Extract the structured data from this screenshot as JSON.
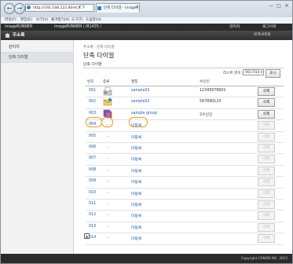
{
  "browser": {
    "address": "http://192.168.222.80/e_a...",
    "tab_title": "단축 다이얼 - imageR...",
    "back_icon": "back-arrow-icon",
    "forward_icon": "forward-arrow-icon",
    "close_tab": "×",
    "win_buttons": [
      "—",
      "□",
      "✕"
    ],
    "menu": [
      "파일(F)",
      "편집(E)",
      "보기(V)",
      "즐겨찾기(A)",
      "도구(T)",
      "도움말(H)"
    ]
  },
  "app": {
    "device": "imageRUNNER",
    "model": "imageRUNNER / iR1435 /",
    "admin": "관리자",
    "logout": "로그아웃",
    "home_label": "주소록",
    "portal": "원격UI포털"
  },
  "sidebar": {
    "items": [
      {
        "label": "원터치"
      },
      {
        "label": "단축 다이얼"
      }
    ]
  },
  "main": {
    "breadcrumb": "주소록 : 단축 다이얼",
    "title": "단축 다이얼",
    "section": "단축 다이얼",
    "list_label": "리스트 번호 :",
    "list_value": "001-014 ▾",
    "show_button": "표시",
    "columns": [
      "번호",
      "종류",
      "명칭",
      "수신인"
    ],
    "rows": [
      {
        "num": "001",
        "type": "fax",
        "name": "sample01",
        "recipient": "12345678901",
        "del": "삭제",
        "enabled": true
      },
      {
        "num": "002",
        "type": "email",
        "name": "sample02",
        "recipient": "567890123",
        "del": "삭제",
        "enabled": true
      },
      {
        "num": "003",
        "type": "group",
        "name": "sample group",
        "recipient": "2수신인",
        "del": "삭제",
        "enabled": true
      },
      {
        "num": "004",
        "type": "none",
        "name": "미등록",
        "recipient": "",
        "del": "삭제",
        "enabled": false
      },
      {
        "num": "005",
        "type": "none",
        "name": "미등록",
        "recipient": "",
        "del": "삭제",
        "enabled": false
      },
      {
        "num": "006",
        "type": "none",
        "name": "미등록",
        "recipient": "",
        "del": "삭제",
        "enabled": false
      },
      {
        "num": "007",
        "type": "none",
        "name": "미등록",
        "recipient": "",
        "del": "삭제",
        "enabled": false
      },
      {
        "num": "008",
        "type": "none",
        "name": "미등록",
        "recipient": "",
        "del": "삭제",
        "enabled": false
      },
      {
        "num": "009",
        "type": "none",
        "name": "미등록",
        "recipient": "",
        "del": "삭제",
        "enabled": false
      },
      {
        "num": "010",
        "type": "none",
        "name": "미등록",
        "recipient": "",
        "del": "삭제",
        "enabled": false
      },
      {
        "num": "011",
        "type": "none",
        "name": "미등록",
        "recipient": "",
        "del": "삭제",
        "enabled": false
      },
      {
        "num": "012",
        "type": "none",
        "name": "미등록",
        "recipient": "",
        "del": "삭제",
        "enabled": false
      },
      {
        "num": "013",
        "type": "none",
        "name": "미등록",
        "recipient": "",
        "del": "삭제",
        "enabled": false
      },
      {
        "num": "014",
        "type": "none",
        "name": "미등록",
        "recipient": "",
        "del": "삭제",
        "enabled": false
      }
    ],
    "type_none_mark": "-"
  },
  "footer": {
    "copyright": "Copyright CANON INC. 2015"
  },
  "colors": {
    "highlight": "#f39a1d",
    "link": "#1a5cb0",
    "header_dark": "#2b2b2b"
  }
}
